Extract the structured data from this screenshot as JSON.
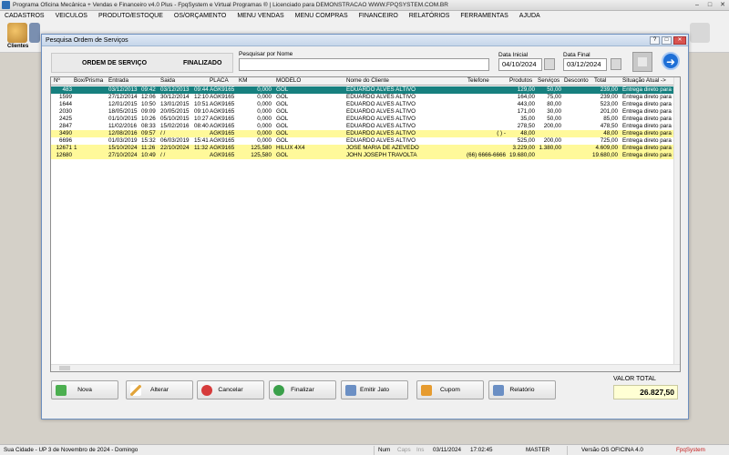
{
  "window": {
    "title": "Programa Oficina Mecânica + Vendas e Financeiro v4.0 Plus - FpqSystem e Virtual Programas ® | Licenciado para  DEMONSTRACAO WWW.FPQSYSTEM.COM.BR",
    "minimize": "–",
    "maximize": "□",
    "close": "✕"
  },
  "menu": [
    "CADASTROS",
    "VEICULOS",
    "PRODUTO/ESTOQUE",
    "OS/ORÇAMENTO",
    "MENU VENDAS",
    "MENU COMPRAS",
    "FINANCEIRO",
    "RELATÓRIOS",
    "FERRAMENTAS",
    "AJUDA"
  ],
  "toolbar": {
    "clientes_label": "Clientes"
  },
  "dialog": {
    "title": "Pesquisa Ordem de Serviços",
    "help_btn": "?",
    "restore_btn": "□",
    "close_btn": "✕",
    "os_label": "ORDEM DE SERVIÇO",
    "status_label": "FINALIZADO",
    "search_label": "Pesquisar por Nome",
    "search_value": "",
    "date_start_label": "Data Inicial",
    "date_start": "04/10/2024",
    "date_end_label": "Data Final",
    "date_end": "03/12/2024",
    "go_icon": "➜"
  },
  "grid": {
    "columns": [
      "Nº",
      "Box/Prisma",
      "Entrada",
      "",
      "Saida",
      "",
      "PLACA",
      "KM",
      "MODELO",
      "Nome do Cliente",
      "Telefone",
      "Produtos",
      "Serviços",
      "Desconto",
      "Total",
      "Situação Atual ->"
    ],
    "rows": [
      {
        "style": "teal",
        "cells": [
          "483",
          "",
          "03/12/2013",
          "09:42",
          "03/12/2013",
          "09:44",
          "AGK9165",
          "0,000",
          "GOL",
          "EDUARDO ALVES ALTIVO",
          "",
          "129,00",
          "50,00",
          "",
          "239,00",
          "Entrega direto para o"
        ]
      },
      {
        "style": "white",
        "cells": [
          "1599",
          "",
          "27/12/2014",
          "12:06",
          "30/12/2014",
          "12:10",
          "AGK9165",
          "0,000",
          "GOL",
          "EDUARDO ALVES ALTIVO",
          "",
          "164,00",
          "75,00",
          "",
          "239,00",
          "Entrega direto para o"
        ]
      },
      {
        "style": "white",
        "cells": [
          "1644",
          "",
          "12/01/2015",
          "10:50",
          "13/01/2015",
          "10:51",
          "AGK9165",
          "0,000",
          "GOL",
          "EDUARDO ALVES ALTIVO",
          "",
          "443,00",
          "80,00",
          "",
          "523,00",
          "Entrega direto para o"
        ]
      },
      {
        "style": "white",
        "cells": [
          "2030",
          "",
          "18/05/2015",
          "09:09",
          "20/05/2015",
          "09:10",
          "AGK9165",
          "0,000",
          "GOL",
          "EDUARDO ALVES ALTIVO",
          "",
          "171,00",
          "30,00",
          "",
          "201,00",
          "Entrega direto para o"
        ]
      },
      {
        "style": "white",
        "cells": [
          "2425",
          "",
          "01/10/2015",
          "10:26",
          "05/10/2015",
          "10:27",
          "AGK9165",
          "0,000",
          "GOL",
          "EDUARDO ALVES ALTIVO",
          "",
          "35,00",
          "50,00",
          "",
          "85,00",
          "Entrega direto para o"
        ]
      },
      {
        "style": "white",
        "cells": [
          "2847",
          "",
          "11/02/2016",
          "08:33",
          "15/02/2016",
          "08:40",
          "AGK9165",
          "0,000",
          "GOL",
          "EDUARDO ALVES ALTIVO",
          "",
          "278,50",
          "200,00",
          "",
          "478,50",
          "Entrega direto para o"
        ]
      },
      {
        "style": "yellow",
        "cells": [
          "3490",
          "",
          "12/08/2016",
          "09:57",
          "/ /",
          "",
          "AGK9165",
          "0,000",
          "GOL",
          "EDUARDO ALVES ALTIVO",
          "(  )   -",
          "48,00",
          "",
          "",
          "48,00",
          "Entrega direto para o"
        ]
      },
      {
        "style": "white",
        "cells": [
          "6696",
          "",
          "01/03/2019",
          "15:32",
          "06/03/2019",
          "15:41",
          "AGK9165",
          "0,000",
          "GOL",
          "EDUARDO ALVES ALTIVO",
          "",
          "525,00",
          "200,00",
          "",
          "725,00",
          "Entrega direto para o"
        ]
      },
      {
        "style": "yellow",
        "cells": [
          "12671",
          "1",
          "15/10/2024",
          "11:26",
          "22/10/2024",
          "11:32",
          "AGK9165",
          "125,580",
          "HILUX 4X4",
          "JOSE MARIA DE AZEVEDO",
          "",
          "3.229,00",
          "1.380,00",
          "",
          "4.609,00",
          "Entrega direto para o"
        ]
      },
      {
        "style": "yellow",
        "cells": [
          "12680",
          "",
          "27/10/2024",
          "10:49",
          "/ /",
          "",
          "AGK9165",
          "125,580",
          "GOL",
          "JOHN JOSEPH TRAVOLTA",
          "(66) 6666-6666",
          "19.680,00",
          "",
          "",
          "19.680,00",
          "Entrega direto para o"
        ]
      }
    ]
  },
  "buttons": {
    "nova": "Nova",
    "alterar": "Alterar",
    "cancelar": "Cancelar",
    "finalizar": "Finalizar",
    "emitir_jato": "Emitir Jato",
    "cupom": "Cupom",
    "relatorio": "Relatório"
  },
  "total": {
    "label": "VALOR TOTAL",
    "value": "26.827,50"
  },
  "statusbar": {
    "city": "Sua Cidade - UP  3 de Novembro de 2024 - Domingo",
    "num": "Num",
    "caps": "Caps",
    "ins": "Ins",
    "date": "03/11/2024",
    "time": "17:02:45",
    "user": "MASTER",
    "version": "Versão OS OFICINA 4.0",
    "brand": "FpqSystem"
  }
}
